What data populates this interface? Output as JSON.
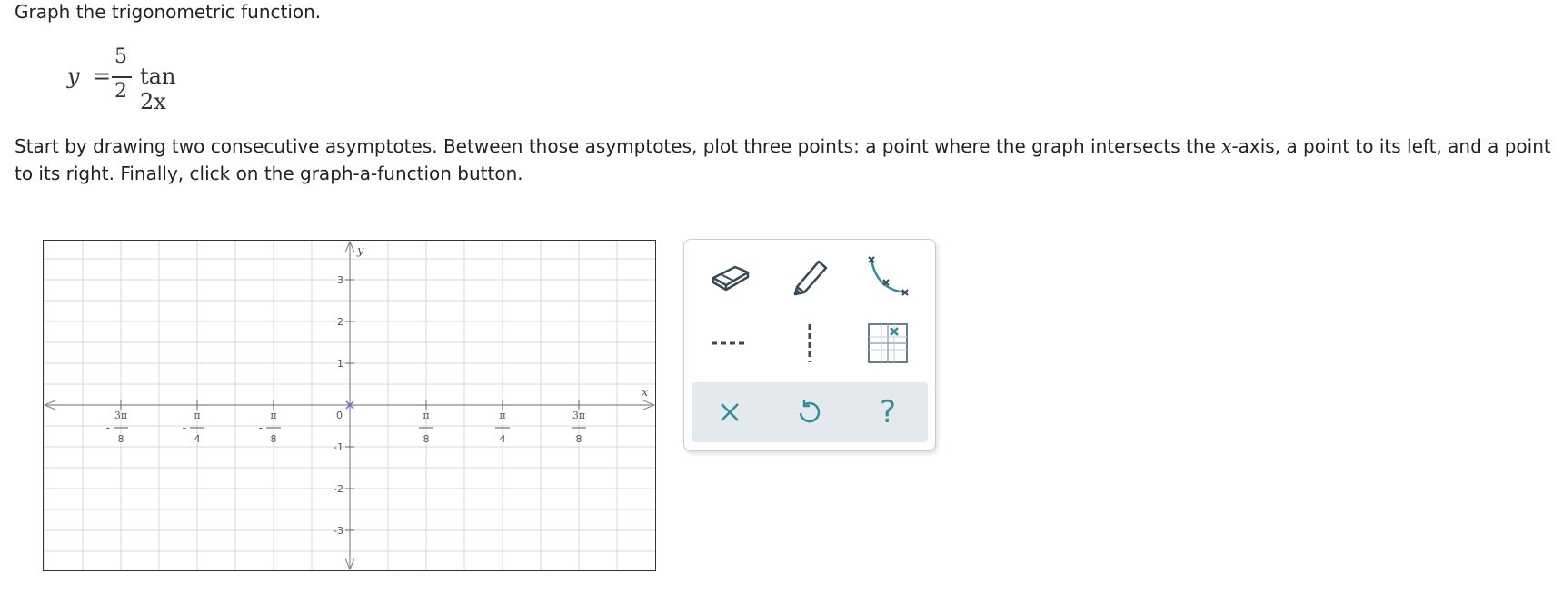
{
  "prompt": "Graph the trigonometric function.",
  "equation": {
    "lhs": "y",
    "equals": "=",
    "numerator": "5",
    "denominator": "2",
    "function": "tan 2x"
  },
  "instructions": {
    "part1": "Start by drawing two consecutive asymptotes. Between those asymptotes, plot three points: a point where the graph intersects the ",
    "var": "x",
    "part2": "-axis, a point to its left, and a point to its right. Finally, click on the graph-a-function button."
  },
  "graph": {
    "x_axis_label": "x",
    "y_axis_label": "y",
    "x_ticks": [
      {
        "value": -3,
        "sign": "-",
        "num": "3π",
        "den": "8"
      },
      {
        "value": -2,
        "sign": "-",
        "num": "π",
        "den": "4"
      },
      {
        "value": -1,
        "sign": "-",
        "num": "π",
        "den": "8"
      },
      {
        "value": 1,
        "sign": "",
        "num": "π",
        "den": "8"
      },
      {
        "value": 2,
        "sign": "",
        "num": "π",
        "den": "4"
      },
      {
        "value": 3,
        "sign": "",
        "num": "3π",
        "den": "8"
      }
    ],
    "origin_label": "0",
    "y_ticks": [
      {
        "value": 3,
        "label": "3"
      },
      {
        "value": 2,
        "label": "2"
      },
      {
        "value": 1,
        "label": "1"
      },
      {
        "value": -1,
        "label": "-1"
      },
      {
        "value": -2,
        "label": "-2"
      },
      {
        "value": -3,
        "label": "-3"
      }
    ],
    "x_range_pi_over_8": [
      -4,
      4
    ],
    "y_range": [
      -4,
      4
    ],
    "grid": true,
    "origin_marker": "x-cross-marker",
    "colors": {
      "grid": "#d9d9d9",
      "axis": "#888888",
      "marker": "#6a6ae0"
    }
  },
  "toolbox": {
    "tools": [
      {
        "name": "eraser-icon"
      },
      {
        "name": "pencil-icon"
      },
      {
        "name": "curve-points-icon"
      },
      {
        "name": "horizontal-asymptote-icon"
      },
      {
        "name": "vertical-asymptote-icon"
      },
      {
        "name": "graph-function-icon"
      }
    ],
    "actions": [
      {
        "name": "clear-icon"
      },
      {
        "name": "undo-icon"
      },
      {
        "name": "help-icon",
        "symbol": "?"
      }
    ],
    "accent": "#2f8e97",
    "dark": "#3a4a55"
  }
}
